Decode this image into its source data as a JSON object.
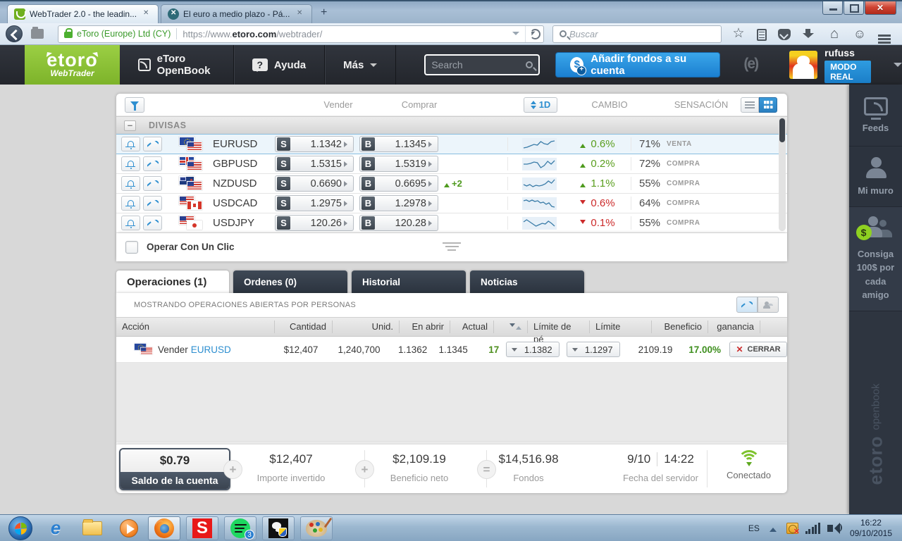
{
  "browser": {
    "tab1": "WebTrader 2.0 - the leadin...",
    "tab2": "El euro a medio plazo - Pá...",
    "cert": "eToro (Europe) Ltd (CY)",
    "url_prefix": "https://www.",
    "url_domain": "etoro.com",
    "url_path": "/webtrader/",
    "search_placeholder": "Buscar"
  },
  "header": {
    "logo": "etoro",
    "logo_sub": "WebTrader",
    "openbook": "eToro OpenBook",
    "ayuda_icon": "?",
    "ayuda": "Ayuda",
    "mas": "Más",
    "search_placeholder": "Search",
    "add_funds": "Añadir fondos a su cuenta",
    "add_funds_icon": "$",
    "username": "rufuss",
    "mode": "MODO REAL"
  },
  "quotes": {
    "col_vender": "Vender",
    "col_comprar": "Comprar",
    "period": "1D",
    "col_cambio": "CAMBIO",
    "col_sensacion": "SENSACIÓN",
    "group": "DIVISAS",
    "sell_letter": "S",
    "buy_letter": "B",
    "one_click": "Operar Con Un Clic",
    "rows": [
      {
        "pair": "EURUSD",
        "sell": "1.1342",
        "buy": "1.1345",
        "badge": "",
        "dir": "up",
        "change": "0.6%",
        "sent": "71%",
        "sent_label": "VENTA",
        "spark": [
          13,
          12,
          10,
          8,
          9,
          4,
          7,
          8,
          4,
          3
        ]
      },
      {
        "pair": "GBPUSD",
        "sell": "1.5315",
        "buy": "1.5319",
        "badge": "",
        "dir": "up",
        "change": "0.2%",
        "sent": "72%",
        "sent_label": "COMPRA",
        "spark": [
          8,
          8,
          7,
          5,
          6,
          13,
          10,
          4,
          8,
          3
        ]
      },
      {
        "pair": "NZDUSD",
        "sell": "0.6690",
        "buy": "0.6695",
        "badge": "+2",
        "dir": "up",
        "change": "1.1%",
        "sent": "55%",
        "sent_label": "COMPRA",
        "spark": [
          9,
          11,
          9,
          12,
          10,
          11,
          10,
          8,
          4,
          7,
          2
        ]
      },
      {
        "pair": "USDCAD",
        "sell": "1.2975",
        "buy": "1.2978",
        "badge": "",
        "dir": "down",
        "change": "0.6%",
        "sent": "64%",
        "sent_label": "COMPRA",
        "spark": [
          4,
          3,
          5,
          3,
          5,
          4,
          7,
          6,
          9,
          7,
          12,
          13
        ]
      },
      {
        "pair": "USDJPY",
        "sell": "120.26",
        "buy": "120.28",
        "badge": "",
        "dir": "down",
        "change": "0.1%",
        "sent": "55%",
        "sent_label": "COMPRA",
        "spark": [
          6,
          3,
          6,
          9,
          12,
          10,
          8,
          9,
          5,
          8,
          12
        ]
      }
    ]
  },
  "dock_tabs": {
    "operaciones": "Operaciones (1)",
    "ordenes": "Ordenes (0)",
    "historial": "Historial",
    "noticias": "Noticias"
  },
  "operations": {
    "showing": "MOSTRANDO OPERACIONES ABIERTAS POR PERSONAS",
    "col_accion": "Acción",
    "col_cantidad": "Cantidad",
    "col_unid": "Unid.",
    "col_en_abrir": "En abrir",
    "col_actual": "Actual",
    "col_limite_perdidas": "Límite de pé",
    "col_limite": "Límite",
    "col_beneficio": "Beneficio",
    "col_ganancia": "ganancia",
    "row": {
      "action": "Vender",
      "pair": "EURUSD",
      "amount": "$12,407",
      "units": "1,240,700",
      "open_rate": "1.1362",
      "current_rate": "1.1345",
      "pips": "17",
      "stop_loss": "1.1382",
      "take_profit": "1.1297",
      "profit": "2109.19",
      "gain": "17.00%",
      "close": "CERRAR"
    }
  },
  "summary": {
    "balance": "$0.79",
    "balance_label": "Saldo de la cuenta",
    "invested": "$12,407",
    "invested_label": "Importe invertido",
    "net_profit": "$2,109.19",
    "net_profit_label": "Beneficio neto",
    "equity": "$14,516.98",
    "equity_label": "Fondos",
    "server_date": "9/10",
    "server_time": "14:22",
    "server_label": "Fecha del servidor",
    "connected": "Conectado"
  },
  "sidebar": {
    "feeds": "Feeds",
    "muro": "Mi muro",
    "consiga": "Consiga 100$ por cada amigo",
    "dollar": "$",
    "brand": "etoro",
    "brand_sub": "openbook"
  },
  "taskbar": {
    "lang": "ES",
    "spotify_badge": "3",
    "s_app": "S",
    "time": "16:22",
    "date": "09/10/2015"
  }
}
